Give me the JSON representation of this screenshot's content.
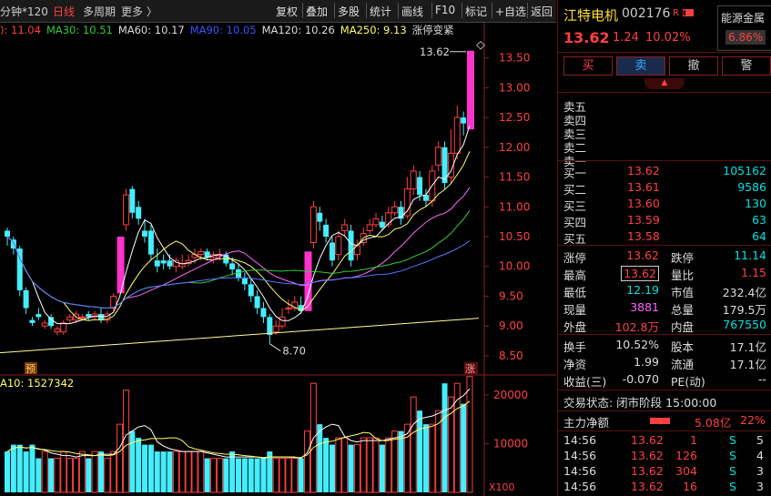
{
  "toolbar": {
    "period_left": "分钟*120",
    "daily": "日线",
    "multi_period": "多周期",
    "more": "更多 〉",
    "buttons": [
      "复权",
      "叠加",
      "多股",
      "统计",
      "画线",
      "F10",
      "标记",
      "+自选",
      "返回"
    ]
  },
  "ma_legend": [
    {
      "text": "): 11.04",
      "color": "#ff4040"
    },
    {
      "text": "MA30: 10.51",
      "color": "#33cc33"
    },
    {
      "text": "MA60: 10.17",
      "color": "#dddddd"
    },
    {
      "text": "MA90: 10.05",
      "color": "#3355ff"
    },
    {
      "text": "MA120: 10.26",
      "color": "#dddddd"
    },
    {
      "text": "MA250: 9.13",
      "color": "#ffff66"
    },
    {
      "text": "涨停变紧",
      "color": "#dddddd"
    }
  ],
  "vol_legend": "A10: 1527342",
  "y_ticks": [
    "13.50",
    "13.00",
    "12.50",
    "12.00",
    "11.50",
    "11.00",
    "10.50",
    "10.00",
    "9.50",
    "9.00",
    "8.50"
  ],
  "vol_ticks": [
    "20000",
    "10000"
  ],
  "vol_unit": "X100",
  "markers": {
    "high_label": "13.62",
    "low_label": "8.70",
    "pre": "预",
    "limit": "涨"
  },
  "chart_data": {
    "type": "candlestick",
    "ylim": [
      8.3,
      13.8
    ],
    "candles": [
      [
        10.6,
        10.5,
        10.65,
        10.35
      ],
      [
        10.45,
        10.3,
        10.5,
        10.2
      ],
      [
        10.3,
        9.6,
        10.35,
        9.5
      ],
      [
        9.6,
        9.3,
        9.65,
        9.2
      ],
      [
        9.1,
        9.05,
        9.15,
        9.0
      ],
      [
        9.2,
        9.15,
        9.3,
        9.1
      ],
      [
        9.0,
        9.05,
        9.1,
        8.95
      ],
      [
        9.15,
        9.0,
        9.2,
        8.95
      ],
      [
        8.9,
        8.95,
        9.0,
        8.85
      ],
      [
        8.9,
        9.05,
        9.1,
        8.85
      ],
      [
        9.1,
        9.15,
        9.2,
        9.05
      ],
      [
        9.1,
        9.2,
        9.25,
        9.05
      ],
      [
        9.15,
        9.15,
        9.2,
        9.1
      ],
      [
        9.2,
        9.15,
        9.25,
        9.1
      ],
      [
        9.15,
        9.2,
        9.25,
        9.1
      ],
      [
        9.2,
        9.1,
        9.3,
        9.05
      ],
      [
        9.1,
        9.2,
        9.25,
        9.05
      ],
      [
        9.3,
        9.5,
        9.55,
        9.25
      ],
      [
        9.55,
        10.5,
        10.5,
        9.55
      ],
      [
        10.7,
        11.2,
        11.3,
        10.6
      ],
      [
        11.3,
        10.9,
        11.35,
        10.8
      ],
      [
        11.0,
        10.8,
        11.1,
        10.7
      ],
      [
        10.6,
        10.5,
        10.8,
        10.4
      ],
      [
        10.6,
        10.2,
        10.7,
        10.1
      ],
      [
        10.1,
        10.0,
        10.3,
        9.9
      ],
      [
        10.1,
        10.05,
        10.2,
        9.95
      ],
      [
        10.1,
        10.0,
        10.2,
        9.95
      ],
      [
        10.0,
        10.1,
        10.15,
        9.9
      ],
      [
        10.0,
        10.05,
        10.2,
        9.95
      ],
      [
        10.05,
        10.1,
        10.2,
        10.0
      ],
      [
        10.15,
        10.2,
        10.3,
        10.05
      ],
      [
        10.2,
        10.25,
        10.3,
        10.1
      ],
      [
        10.25,
        10.15,
        10.3,
        10.1
      ],
      [
        10.15,
        10.2,
        10.25,
        10.05
      ],
      [
        10.2,
        10.2,
        10.3,
        10.1
      ],
      [
        10.2,
        10.05,
        10.25,
        10.0
      ],
      [
        10.05,
        9.95,
        10.15,
        9.85
      ],
      [
        9.95,
        9.8,
        10.05,
        9.75
      ],
      [
        9.8,
        9.7,
        9.9,
        9.6
      ],
      [
        9.7,
        9.5,
        9.8,
        9.4
      ],
      [
        9.5,
        9.3,
        9.6,
        9.2
      ],
      [
        9.3,
        9.15,
        9.4,
        9.05
      ],
      [
        9.15,
        8.85,
        9.2,
        8.7
      ],
      [
        8.9,
        9.0,
        9.1,
        8.85
      ],
      [
        9.0,
        9.15,
        9.3,
        8.95
      ],
      [
        9.3,
        9.3,
        9.45,
        9.2
      ],
      [
        9.3,
        9.4,
        9.5,
        9.25
      ],
      [
        9.35,
        9.25,
        9.5,
        9.2
      ],
      [
        9.25,
        10.25,
        10.25,
        9.25
      ],
      [
        10.4,
        11.0,
        11.1,
        10.3
      ],
      [
        10.9,
        10.75,
        11.0,
        10.6
      ],
      [
        10.7,
        10.5,
        10.8,
        10.4
      ],
      [
        10.4,
        10.1,
        10.5,
        10.0
      ],
      [
        10.2,
        10.5,
        10.6,
        10.1
      ],
      [
        10.6,
        10.7,
        10.8,
        10.5
      ],
      [
        10.6,
        10.1,
        10.7,
        10.0
      ],
      [
        10.2,
        10.35,
        10.45,
        10.1
      ],
      [
        10.4,
        10.55,
        10.65,
        10.35
      ],
      [
        10.6,
        10.7,
        10.8,
        10.55
      ],
      [
        10.7,
        10.8,
        10.9,
        10.65
      ],
      [
        10.75,
        10.65,
        10.85,
        10.6
      ],
      [
        10.7,
        10.9,
        11.0,
        10.65
      ],
      [
        10.9,
        11.0,
        11.1,
        10.85
      ],
      [
        11.0,
        10.8,
        11.1,
        10.7
      ],
      [
        10.85,
        11.3,
        11.5,
        10.8
      ],
      [
        11.3,
        11.6,
        11.7,
        11.2
      ],
      [
        11.5,
        11.2,
        11.6,
        11.1
      ],
      [
        11.2,
        11.1,
        11.3,
        11.0
      ],
      [
        11.1,
        11.6,
        11.7,
        11.0
      ],
      [
        11.7,
        12.0,
        12.1,
        11.6
      ],
      [
        12.0,
        11.4,
        12.1,
        11.3
      ],
      [
        11.5,
        11.9,
        12.3,
        11.4
      ],
      [
        11.9,
        12.5,
        12.7,
        11.8
      ],
      [
        12.5,
        12.4,
        12.6,
        12.2
      ],
      [
        12.3,
        13.62,
        13.62,
        12.3
      ]
    ],
    "limit_up_indices": [
      18,
      48,
      74
    ],
    "volumes": [
      6,
      7,
      7,
      6,
      7,
      5,
      6,
      5,
      5,
      6,
      5,
      5,
      6,
      5,
      6,
      6,
      5,
      6,
      10,
      15,
      9,
      8,
      7,
      7,
      6,
      6,
      6,
      6,
      6,
      6,
      6,
      6,
      5,
      5,
      5,
      5,
      6,
      5,
      5,
      5,
      5,
      5,
      6,
      5,
      5,
      5,
      5,
      5,
      9,
      16,
      10,
      8,
      7,
      8,
      8,
      7,
      7,
      8,
      8,
      8,
      7,
      8,
      9,
      9,
      10,
      14,
      12,
      10,
      10,
      12,
      16,
      14,
      16,
      13,
      17
    ],
    "vol_ylim": [
      0,
      23000
    ]
  },
  "stock": {
    "name": "江特电机",
    "code": "002176",
    "badge": "R",
    "sector": "能源金属",
    "sector_pct": "6.86%",
    "price": "13.62",
    "change": "1.24",
    "pct": "10.02%"
  },
  "trade_buttons": [
    "买",
    "卖",
    "撤",
    "警"
  ],
  "sell_levels": [
    "卖五",
    "卖四",
    "卖三",
    "卖二",
    "卖一"
  ],
  "buy_levels": [
    {
      "label": "买一",
      "price": "13.62",
      "vol": "105162"
    },
    {
      "label": "买二",
      "price": "13.61",
      "vol": "9586"
    },
    {
      "label": "买三",
      "price": "13.60",
      "vol": "130"
    },
    {
      "label": "买四",
      "price": "13.59",
      "vol": "63"
    },
    {
      "label": "买五",
      "price": "13.58",
      "vol": "64"
    }
  ],
  "stats": [
    {
      "l1": "涨停",
      "v1": "13.62",
      "c1": "red",
      "l2": "跌停",
      "v2": "11.14",
      "c2": "green"
    },
    {
      "l1": "最高",
      "v1": "13.62",
      "c1": "red",
      "l2": "量比",
      "v2": "1.15",
      "c2": "red"
    },
    {
      "l1": "最低",
      "v1": "12.19",
      "c1": "green",
      "l2": "市值",
      "v2": "232.4亿",
      "c2": "white"
    },
    {
      "l1": "现量",
      "v1": "3881",
      "c1": "pink",
      "l2": "总量",
      "v2": "179.5万",
      "c2": "white"
    },
    {
      "l1": "外盘",
      "v1": "102.8万",
      "c1": "red",
      "l2": "内盘",
      "v2": "767550",
      "c2": "green"
    }
  ],
  "stats2": [
    {
      "l1": "换手",
      "v1": "10.52%",
      "l2": "股本",
      "v2": "17.1亿"
    },
    {
      "l1": "净资",
      "v1": "1.99",
      "l2": "流通",
      "v2": "17.1亿"
    },
    {
      "l1": "收益(三)",
      "v1": "-0.070",
      "l2": "PE(动)",
      "v2": "--"
    }
  ],
  "trade_status": "交易状态: 闭市阶段 15:00:00",
  "main_flow": {
    "label": "主力净额",
    "value": "5.08亿",
    "pct": "22%"
  },
  "ticks": [
    {
      "time": "14:56",
      "price": "13.62",
      "vol": "1",
      "side": "S",
      "n": "5"
    },
    {
      "time": "14:56",
      "price": "13.62",
      "vol": "126",
      "side": "S",
      "n": "4"
    },
    {
      "time": "14:56",
      "price": "13.62",
      "vol": "304",
      "side": "S",
      "n": "3"
    },
    {
      "time": "14:56",
      "price": "13.62",
      "vol": "16",
      "side": "S",
      "n": "3"
    }
  ]
}
